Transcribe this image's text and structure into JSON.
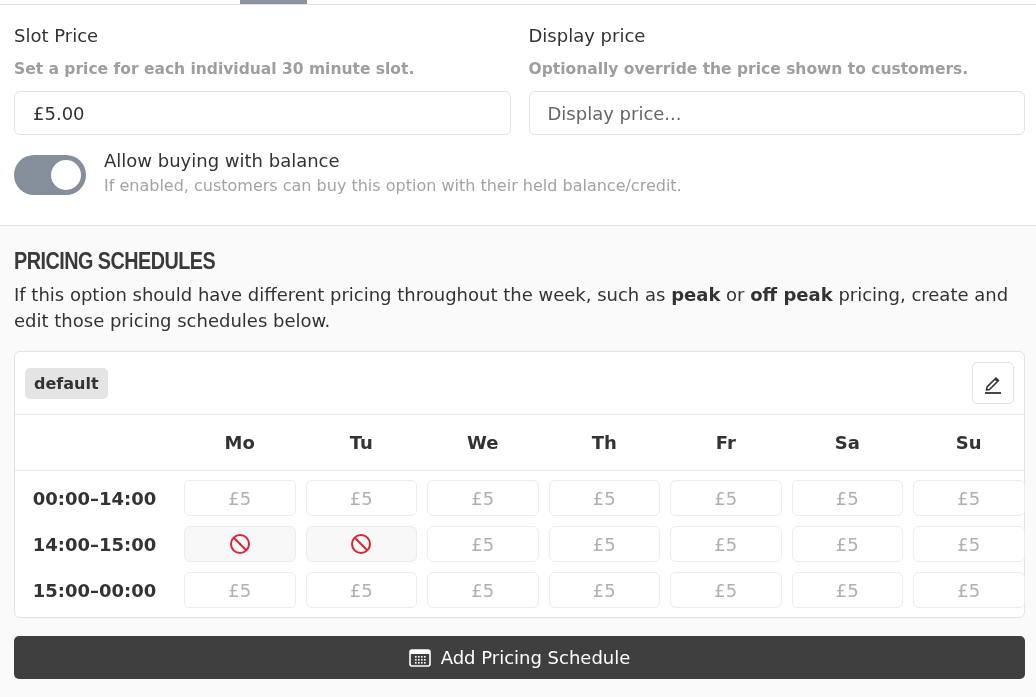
{
  "tabs": [
    {
      "selected": true
    }
  ],
  "fields": [
    {
      "label": "Slot Price",
      "hint": "Set a price for each individual 30 minute slot.",
      "value": "£5.00"
    },
    {
      "label": "Display price",
      "hint": "Optionally override the price shown to customers.",
      "placeholder": "Display price..."
    }
  ],
  "balance_toggle": {
    "on": true,
    "label": "Allow buying with balance",
    "description": "If enabled, customers can buy this option with their held balance/credit."
  },
  "pricing_schedules": {
    "title": "PRICING SCHEDULES",
    "description": "If this option should have different pricing throughout the week, such as **peak** or **off peak** pricing, create and edit those pricing schedules below.",
    "schedule": {
      "name": "default",
      "days": [
        "Mo",
        "Tu",
        "We",
        "Th",
        "Fr",
        "Sa",
        "Su"
      ],
      "rows": [
        {
          "time": "00:00–14:00",
          "cells": [
            {
              "kind": "price",
              "text": "£5"
            },
            {
              "kind": "price",
              "text": "£5"
            },
            {
              "kind": "price",
              "text": "£5"
            },
            {
              "kind": "price",
              "text": "£5"
            },
            {
              "kind": "price",
              "text": "£5"
            },
            {
              "kind": "price",
              "text": "£5"
            },
            {
              "kind": "price",
              "text": "£5"
            }
          ]
        },
        {
          "time": "14:00–15:00",
          "cells": [
            {
              "kind": "blocked"
            },
            {
              "kind": "blocked"
            },
            {
              "kind": "price",
              "text": "£5"
            },
            {
              "kind": "price",
              "text": "£5"
            },
            {
              "kind": "price",
              "text": "£5"
            },
            {
              "kind": "price",
              "text": "£5"
            },
            {
              "kind": "price",
              "text": "£5"
            }
          ]
        },
        {
          "time": "15:00–00:00",
          "cells": [
            {
              "kind": "price",
              "text": "£5"
            },
            {
              "kind": "price",
              "text": "£5"
            },
            {
              "kind": "price",
              "text": "£5"
            },
            {
              "kind": "price",
              "text": "£5"
            },
            {
              "kind": "price",
              "text": "£5"
            },
            {
              "kind": "price",
              "text": "£5"
            },
            {
              "kind": "price",
              "text": "£5"
            }
          ]
        }
      ]
    },
    "add_button": "Add Pricing Schedule"
  }
}
